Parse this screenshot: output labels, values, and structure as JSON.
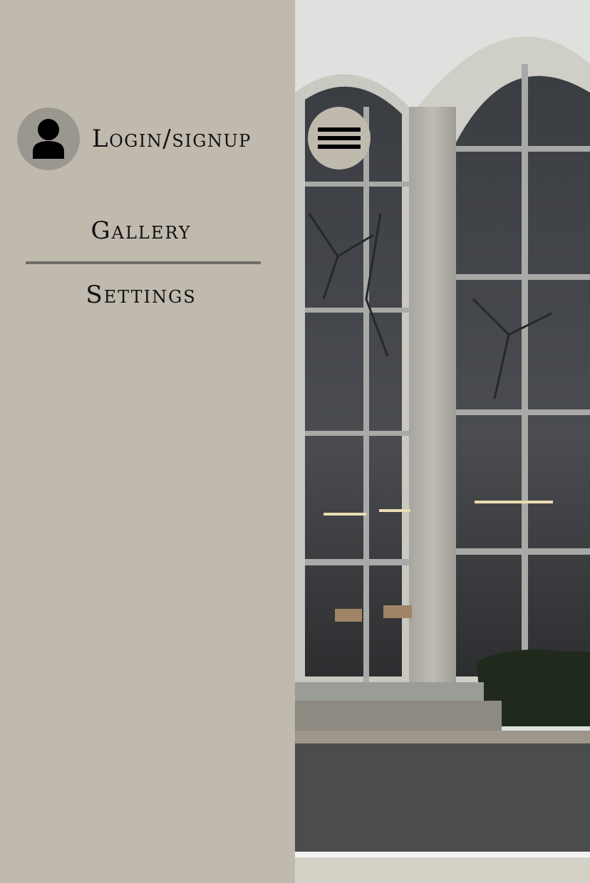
{
  "drawer": {
    "login_label": "Login/signup",
    "avatar_icon": "user-icon",
    "nav_items": [
      {
        "label": "Gallery"
      },
      {
        "label": "Settings"
      }
    ]
  },
  "menu_toggle": {
    "icon": "hamburger-icon"
  },
  "colors": {
    "drawer_background": "#c0b9ad",
    "menu_toggle_background": "#c0b9ad",
    "avatar_background": "#9a9790",
    "divider": "#6f6d68",
    "text": "#111111"
  }
}
